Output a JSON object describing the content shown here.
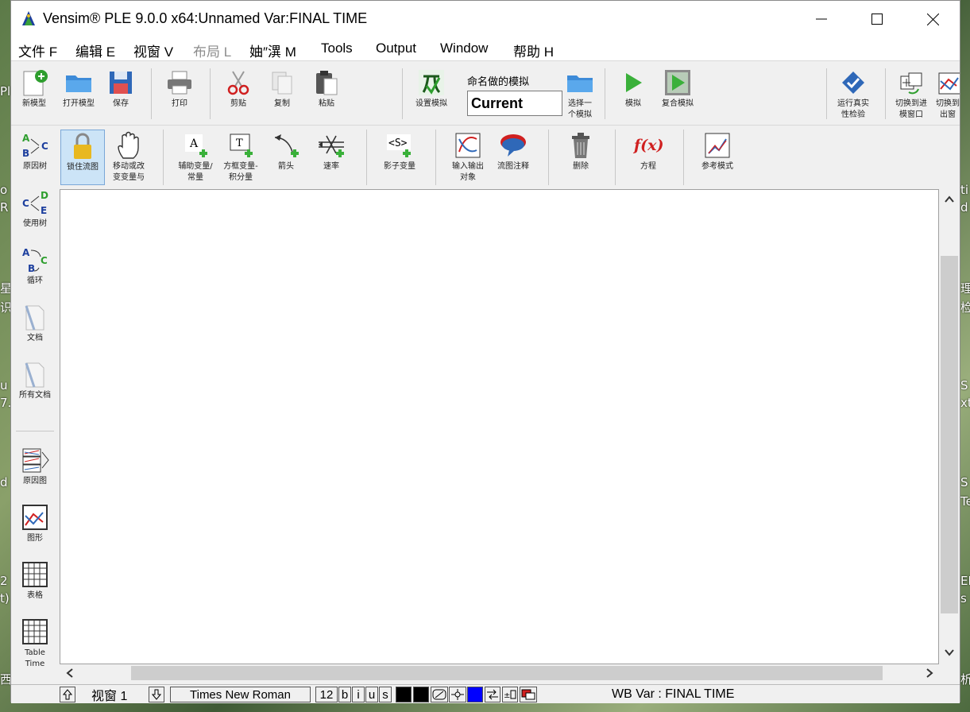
{
  "window": {
    "title": "Vensim® PLE 9.0.0 x64:Unnamed Var:FINAL TIME"
  },
  "menu": [
    "文件 F",
    "编辑 E",
    "视窗 V",
    "布局 L",
    "妯″潩 M",
    "Tools",
    "Output",
    "Window",
    "帮助 H"
  ],
  "toolbar1": {
    "new": "新模型",
    "open": "打开模型",
    "save": "保存",
    "print": "打印",
    "cut": "剪贴",
    "copy": "复制",
    "paste": "粘贴",
    "setup_sim": "设置模拟",
    "sim_name_label": "命名做的模拟",
    "sim_name_value": "Current",
    "choose_sim_1": "选择一",
    "choose_sim_2": "个模拟",
    "simulate": "模拟",
    "synthesim": "复合模拟",
    "reality_check_1": "运行真实",
    "reality_check_2": "性检验",
    "to_workbench_1": "切换到进",
    "to_workbench_2": "模窗口",
    "to_output_1": "切换到",
    "to_output_2": "出窗"
  },
  "toolbar2": {
    "lock": "锁住流图",
    "move_1": "移动或改",
    "move_2": "变变量与",
    "aux_1": "辅助变量/",
    "aux_2": "常量",
    "box_1": "方框变量-",
    "box_2": "积分量",
    "arrow": "箭头",
    "rate": "速率",
    "shadow": "影子变量",
    "io_1": "输入输出",
    "io_2": "对象",
    "comment": "流图注释",
    "delete": "删除",
    "equation": "方程",
    "ref_mode": "参考模式"
  },
  "toolbox": {
    "causes_tree": "原因树",
    "uses_tree": "使用树",
    "loops": "循环",
    "document": "文档",
    "all_docs": "所有文档",
    "causes_strip": "原因图",
    "graph": "图形",
    "table": "表格",
    "table_time_1": "Table",
    "table_time_2": "Time"
  },
  "status": {
    "view": "视窗 1",
    "font": "Times New Roman",
    "size": "12",
    "bold": "b",
    "italic": "i",
    "underline": "u",
    "strike": "s",
    "workbench": "WB Var : FINAL TIME"
  },
  "desktop_edge": [
    "Pl",
    "o",
    "R",
    "星",
    "识",
    "u",
    "7.",
    "d",
    "2",
    "t)",
    "西",
    "ti",
    "d",
    "理",
    "检",
    "S",
    "xt",
    "S",
    "Te",
    "EI",
    "s",
    "析"
  ],
  "colors": {
    "accent_blue": "#0000ff",
    "green": "#2e9e2e"
  }
}
